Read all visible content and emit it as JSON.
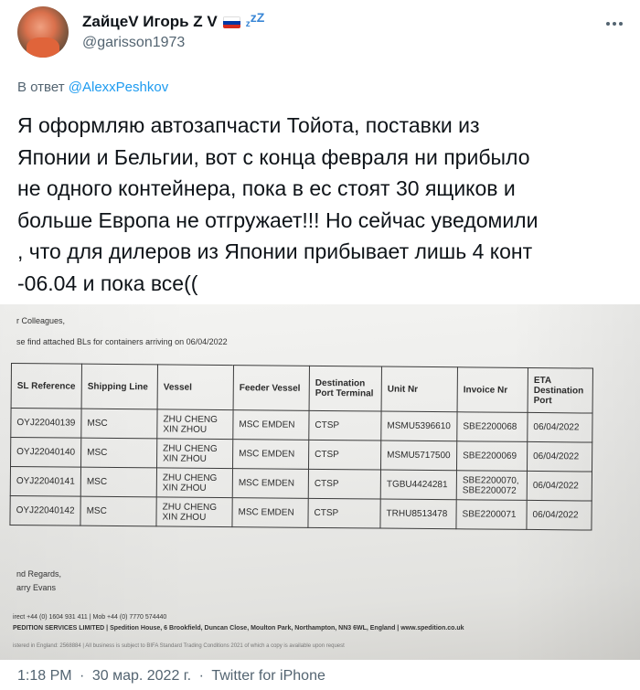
{
  "author": {
    "display_name": "ZайцеV Игорь Z V",
    "zz": "zZ",
    "zz_small": "z",
    "handle": "@garisson1973"
  },
  "reply": {
    "prefix": "В ответ",
    "mention": "@AlexxPeshkov"
  },
  "tweet_text": "Я оформляю автозапчасти Тойота, поставки из\nЯпонии и Бельгии, вот с конца февраля ни прибыло\nне одного контейнера, пока в ес стоят 30 ящиков и\nбольше Европа не отгружает!!! Но сейчас уведомили\n, что для дилеров из Японии прибывает лишь 4 конт\n-06.04 и пока все((",
  "photo": {
    "greeting": "r Colleagues,",
    "intro": "se find attached BLs for containers arriving on 06/04/2022",
    "columns": [
      "SL Reference",
      "Shipping Line",
      "Vessel",
      "Feeder Vessel",
      "Destination Port Terminal",
      "Unit Nr",
      "Invoice Nr",
      "ETA Destination Port"
    ],
    "rows": [
      {
        "ref": "OYJ22040139",
        "line": "MSC",
        "vessel": "ZHU CHENG XIN ZHOU",
        "feeder": "MSC EMDEN",
        "terminal": "CTSP",
        "unit": "MSMU5396610",
        "invoice": "SBE2200068",
        "eta": "06/04/2022"
      },
      {
        "ref": "OYJ22040140",
        "line": "MSC",
        "vessel": "ZHU CHENG XIN ZHOU",
        "feeder": "MSC EMDEN",
        "terminal": "CTSP",
        "unit": "MSMU5717500",
        "invoice": "SBE2200069",
        "eta": "06/04/2022"
      },
      {
        "ref": "OYJ22040141",
        "line": "MSC",
        "vessel": "ZHU CHENG XIN ZHOU",
        "feeder": "MSC EMDEN",
        "terminal": "CTSP",
        "unit": "TGBU4424281",
        "invoice": "SBE2200070, SBE2200072",
        "eta": "06/04/2022"
      },
      {
        "ref": "OYJ22040142",
        "line": "MSC",
        "vessel": "ZHU CHENG XIN ZHOU",
        "feeder": "MSC EMDEN",
        "terminal": "CTSP",
        "unit": "TRHU8513478",
        "invoice": "SBE2200071",
        "eta": "06/04/2022"
      }
    ],
    "regards": "nd Regards,",
    "signer": "arry Evans",
    "contact": "irect +44 (0) 1604 931 411 | Mob +44 (0) 7770 574440",
    "company": "PEDITION SERVICES LIMITED | Spedition House, 6 Brookfield, Duncan Close, Moulton Park, Northampton, NN3 6WL, England | www.spedition.co.uk",
    "legal": "istered in England: 2568884 | All business is subject to BIFA Standard Trading Conditions 2021 of which a copy is available upon request"
  },
  "meta": {
    "time": "1:18 PM",
    "date": "30 мар. 2022 г.",
    "source": "Twitter for iPhone",
    "separator": "·"
  },
  "colors": {
    "link": "#1d9bf0",
    "secondary_text": "#536471",
    "zz_blue": "#3a87d6",
    "flag": [
      "#ffffff",
      "#0039a6",
      "#d52b1e"
    ]
  }
}
